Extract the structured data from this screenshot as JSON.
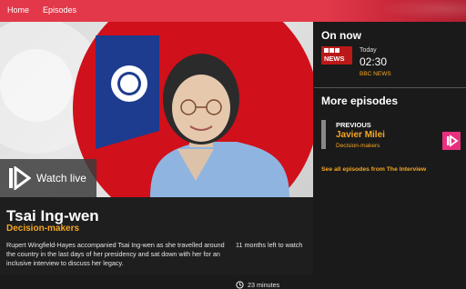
{
  "nav": {
    "home": "Home",
    "episodes": "Episodes"
  },
  "hero": {
    "watch_label": "Watch live"
  },
  "episode": {
    "title": "Tsai Ing-wen",
    "series": "Decision-makers",
    "description": "Rupert Wingfield-Hayes accompanied Tsai Ing-wen as she travelled around the country in the last days of her presidency and sat down with her for an inclusive interview to discuss her legacy.",
    "time_left": "11 months left to watch",
    "duration": "23 minutes"
  },
  "on_now": {
    "heading": "On now",
    "logo_text": "NEWS",
    "day": "Today",
    "time": "02:30",
    "channel": "BBC NEWS"
  },
  "more_episodes": {
    "heading": "More episodes",
    "previous_label": "PREVIOUS",
    "previous_name": "Javier Milei",
    "previous_series": "Decision-makers",
    "see_all": "See all episodes from The Interview"
  },
  "colors": {
    "accent": "#f5a623",
    "brand_red": "#e2384a",
    "pink": "#e8307f",
    "bbc_news_red": "#bb1919"
  },
  "icons": [
    "iplayer-icon",
    "play-icon",
    "clock-icon"
  ]
}
